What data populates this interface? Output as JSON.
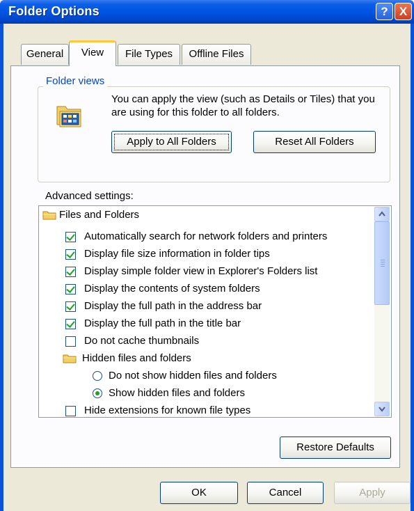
{
  "window": {
    "title": "Folder Options",
    "help_button": "?",
    "close_button": "X"
  },
  "tabs": [
    {
      "label": "General",
      "active": false
    },
    {
      "label": "View",
      "active": true
    },
    {
      "label": "File Types",
      "active": false
    },
    {
      "label": "Offline Files",
      "active": false
    }
  ],
  "folder_views": {
    "title": "Folder views",
    "description": "You can apply the view (such as Details or Tiles) that you are using for this folder to all folders.",
    "icon": "folder-tiles-icon",
    "apply_button": "Apply to All Folders",
    "reset_button": "Reset All Folders"
  },
  "advanced": {
    "label": "Advanced settings:",
    "items": [
      {
        "type": "folder",
        "label": "Files and Folders"
      },
      {
        "type": "checkbox",
        "label": "Automatically search for network folders and printers",
        "checked": true
      },
      {
        "type": "checkbox",
        "label": "Display file size information in folder tips",
        "checked": true
      },
      {
        "type": "checkbox",
        "label": "Display simple folder view in Explorer's Folders list",
        "checked": true
      },
      {
        "type": "checkbox",
        "label": "Display the contents of system folders",
        "checked": true
      },
      {
        "type": "checkbox",
        "label": "Display the full path in the address bar",
        "checked": true
      },
      {
        "type": "checkbox",
        "label": "Display the full path in the title bar",
        "checked": true
      },
      {
        "type": "checkbox",
        "label": "Do not cache thumbnails",
        "checked": false
      },
      {
        "type": "folder",
        "label": "Hidden files and folders"
      },
      {
        "type": "radio",
        "label": "Do not show hidden files and folders",
        "checked": false
      },
      {
        "type": "radio",
        "label": "Show hidden files and folders",
        "checked": true
      },
      {
        "type": "checkbox",
        "label": "Hide extensions for known file types",
        "checked": false
      }
    ],
    "restore_button": "Restore Defaults"
  },
  "footer": {
    "ok": "OK",
    "cancel": "Cancel",
    "apply": "Apply"
  },
  "colors": {
    "titlebar": "#0054e3",
    "dialog_bg": "#ece9d8",
    "group_title": "#0046d5",
    "check_mark": "#21a121"
  }
}
